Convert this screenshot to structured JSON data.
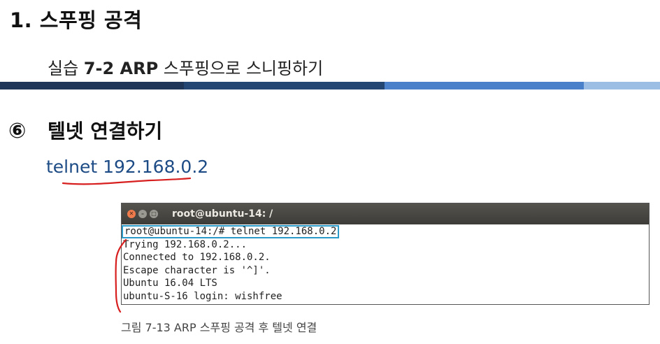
{
  "header": {
    "title": "1. 스푸핑 공격",
    "subtitle_prefix": "실습 ",
    "subtitle_bold": "7-2 ARP",
    "subtitle_suffix": " 스푸핑으로 스니핑하기"
  },
  "divider": {
    "colors": [
      "#1f3658",
      "#244672",
      "#4a7fc9",
      "#9cbde4"
    ]
  },
  "step": {
    "number": "⑥",
    "title": "텔넷 연결하기",
    "command": "telnet 192.168.0.2"
  },
  "terminal": {
    "window_title": "root@ubuntu-14: /",
    "buttons": [
      "close-icon",
      "minimize-icon",
      "maximize-icon"
    ],
    "lines": [
      "root@ubuntu-14:/# telnet 192.168.0.2",
      "Trying 192.168.0.2...",
      "Connected to 192.168.0.2.",
      "Escape character is '^]'.",
      "Ubuntu 16.04 LTS",
      "ubuntu-S-16 login: wishfree"
    ],
    "highlight_color": "#2c9ac8",
    "annotation_color": "#d81f1f"
  },
  "caption": {
    "text": "그림 7-13  ARP 스푸핑 공격 후 텔넷 연결"
  }
}
